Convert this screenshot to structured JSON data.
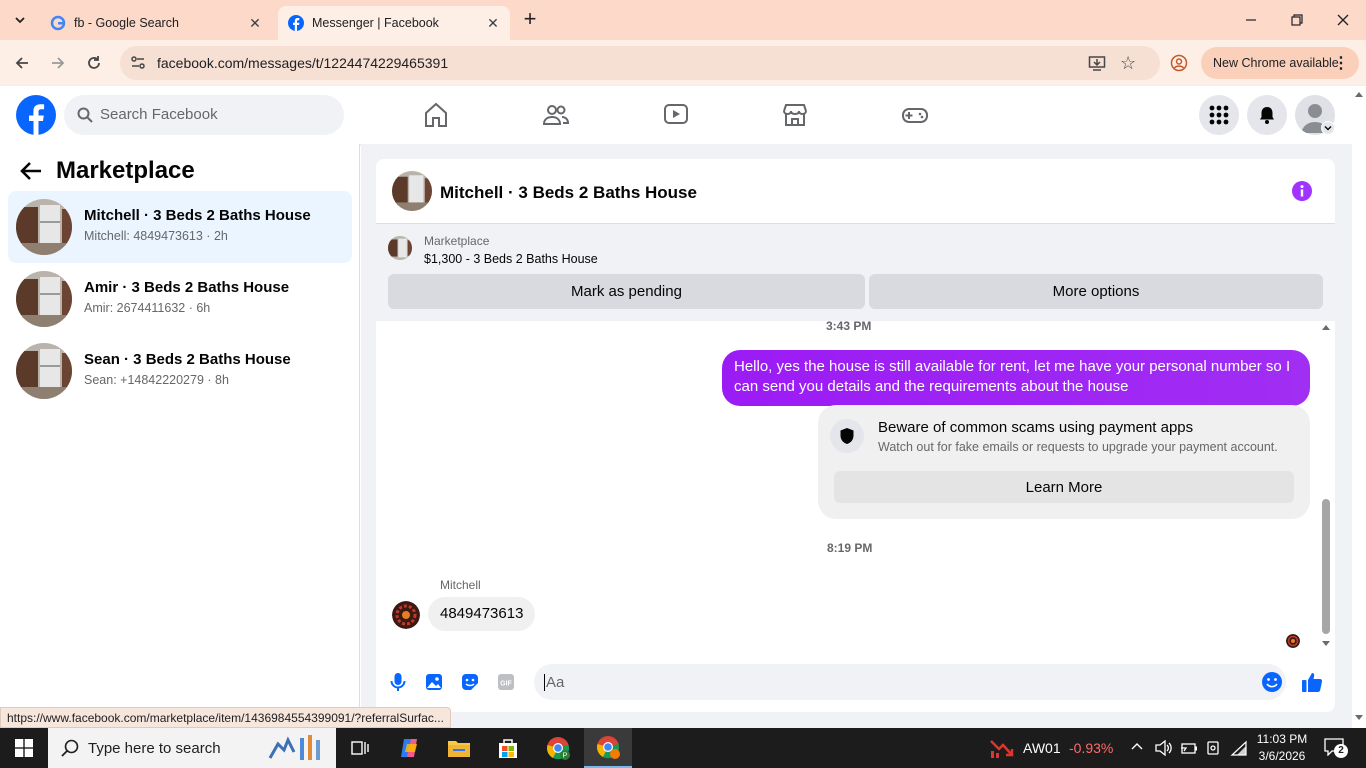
{
  "browser": {
    "tabs": [
      {
        "title": "fb - Google Search",
        "icon": "google-icon"
      },
      {
        "title": "Messenger | Facebook",
        "icon": "facebook-icon"
      }
    ],
    "url": "facebook.com/messages/t/1224474229465391",
    "update_label": "New Chrome available",
    "status_url": "https://www.facebook.com/marketplace/item/1436984554399091/?referralSurfac..."
  },
  "fb": {
    "search_placeholder": "Search Facebook"
  },
  "sidebar": {
    "title": "Marketplace",
    "conversations": [
      {
        "name": "Mitchell · 3 Beds 2 Baths House",
        "preview": "Mitchell: 4849473613 · 2h",
        "selected": true
      },
      {
        "name": "Amir · 3 Beds 2 Baths House",
        "preview": "Amir: 2674411632 · 6h",
        "selected": false
      },
      {
        "name": "Sean · 3 Beds 2 Baths House",
        "preview": "Sean: +14842220279 · 8h",
        "selected": false
      }
    ]
  },
  "chat": {
    "title": "Mitchell · 3 Beds 2 Baths House",
    "marketplace_label": "Marketplace",
    "listing": "$1,300 - 3 Beds 2 Baths House",
    "mark_pending": "Mark as pending",
    "more_options": "More options",
    "time1": "3:43 PM",
    "outgoing": "Hello, yes the house is still available for rent, let me have your personal number so I can send you details and the requirements about the house",
    "scam_title": "Beware of common scams using payment apps",
    "scam_body": "Watch out for fake emails or requests to upgrade your payment account.",
    "learn_more": "Learn More",
    "time2": "8:19 PM",
    "sender": "Mitchell",
    "incoming": "4849473613",
    "composer_placeholder": "Aa"
  },
  "taskbar": {
    "search_placeholder": "Type here to search",
    "stock_name": "AW01",
    "stock_change": "-0.93%",
    "time": "11:03 PM",
    "date": "3/6/2026",
    "notifications": "2"
  },
  "colors": {
    "accent": "#0866ff",
    "bubble": "#a033ff",
    "stock_red": "#ff5c5c"
  }
}
